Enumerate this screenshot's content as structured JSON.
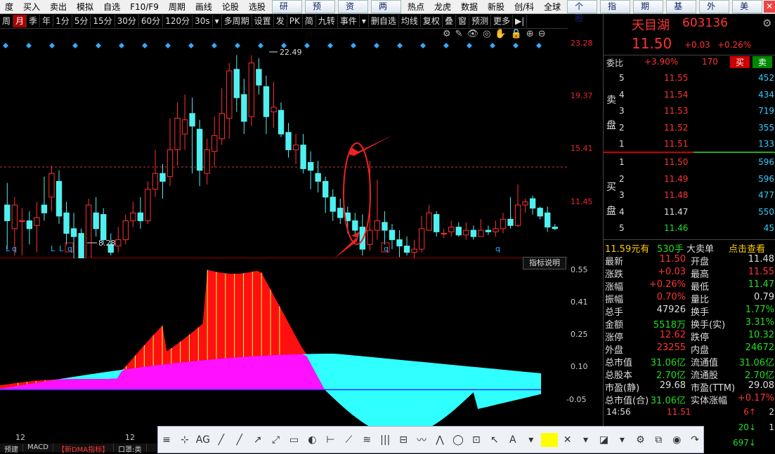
{
  "menu": {
    "items": [
      "买入",
      "卖出",
      "模拟",
      "自选",
      "F10/F9",
      "周期",
      "画线",
      "论股",
      "选股"
    ],
    "lead": "度",
    "tabs": [
      "研报",
      "预测",
      "资金",
      "两融"
    ],
    "items2": [
      "热点",
      "龙虎",
      "数据",
      "新股",
      "创/科",
      "全球"
    ],
    "tabs2": [
      "个股",
      "指数",
      "期货",
      "基金",
      "外汇",
      "美股"
    ],
    "close": "✕"
  },
  "periods": [
    "周",
    "月",
    "季",
    "年",
    "1分",
    "5分",
    "15分",
    "30分",
    "60分",
    "120分",
    "30s",
    "▾",
    "多周期",
    "设置",
    "发",
    "PK",
    "简",
    "九转",
    "事件",
    "▾",
    "删自选",
    "均线",
    "复权",
    "叠",
    "窗",
    "预测",
    "更多",
    "▶|"
  ],
  "period_selected": 1,
  "y_labels": [
    "23.28",
    "19.37",
    "15.41",
    "11.45"
  ],
  "price_annotations": {
    "high": "22.49",
    "low": "8.28"
  },
  "markers": [
    "L",
    "q",
    "L",
    "L",
    "q",
    "q",
    "q"
  ],
  "indicator": {
    "button": "指标说明",
    "y_labels": [
      "0.55",
      "0.41",
      "0.25",
      "0.10",
      "-0.05"
    ]
  },
  "x_labels": [
    "12",
    "12"
  ],
  "stock": {
    "name": "天目湖",
    "code": "603136",
    "price": "11.50",
    "change": "+0.03",
    "pct": "+0.26%"
  },
  "weibi": {
    "label": "委比",
    "value": "+3.90%",
    "diff": "170",
    "buy_btn": "买",
    "sell_btn": "卖"
  },
  "sell_label": [
    "卖",
    "盘"
  ],
  "buy_label": [
    "买",
    "盘"
  ],
  "asks": [
    {
      "lvl": "5",
      "price": "11.55",
      "vol": "452"
    },
    {
      "lvl": "4",
      "price": "11.54",
      "vol": "434"
    },
    {
      "lvl": "3",
      "price": "11.53",
      "vol": "719"
    },
    {
      "lvl": "2",
      "price": "11.52",
      "vol": "355"
    },
    {
      "lvl": "1",
      "price": "11.51",
      "vol": "133"
    }
  ],
  "bids": [
    {
      "lvl": "1",
      "price": "11.50",
      "vol": "596"
    },
    {
      "lvl": "2",
      "price": "11.49",
      "vol": "596"
    },
    {
      "lvl": "3",
      "price": "11.48",
      "vol": "477"
    },
    {
      "lvl": "4",
      "price": "11.47",
      "vol": "550"
    },
    {
      "lvl": "5",
      "price": "11.46",
      "vol": "45"
    }
  ],
  "bigorder": {
    "p": "11.59元有",
    "v": "530手",
    "t": "大卖单",
    "link": "点击查看"
  },
  "stats": [
    [
      "最新",
      "11.50",
      "开盘",
      "11.48"
    ],
    [
      "涨跌",
      "+0.03",
      "最高",
      "11.55"
    ],
    [
      "涨幅",
      "+0.26%",
      "最低",
      "11.47"
    ],
    [
      "振幅",
      "0.70%",
      "量比",
      "0.79"
    ],
    [
      "总手",
      "47926",
      "换手",
      "1.77%"
    ],
    [
      "金额",
      "5518万",
      "换手(实)",
      "3.31%"
    ],
    [
      "涨停",
      "12.62",
      "跌停",
      "10.32"
    ],
    [
      "外盘",
      "23255",
      "内盘",
      "24672"
    ],
    [
      "总市值",
      "31.06亿",
      "流通值",
      "31.06亿"
    ],
    [
      "总股本",
      "2.70亿",
      "流通股",
      "2.70亿"
    ],
    [
      "市盈(静)",
      "29.68",
      "市盈(TTM)",
      "29.08"
    ],
    [
      "总市值(合)",
      "31.06亿",
      "实体涨幅",
      "+0.17%"
    ]
  ],
  "ticks": [
    {
      "time": "14:56",
      "price": "11.51",
      "vol": "6↑",
      "n": "2"
    },
    {
      "time": "",
      "price": "",
      "vol": "20↓",
      "n": "1"
    },
    {
      "time": "",
      "price": "",
      "vol": "697↓",
      "n": ""
    }
  ],
  "bottom_tabs": [
    "预建",
    "MACD",
    "【新DMA指标】",
    "口罩:类"
  ],
  "drawtools": [
    "≡",
    "⊹",
    "AG",
    "╱",
    "╱",
    "↗",
    "⤢",
    "▭",
    "◐",
    "⊢",
    "⟋",
    "≋",
    "|||",
    "⊟",
    "〰",
    "⋀",
    "◯",
    "⊡",
    "↖",
    "A",
    "▾",
    "■",
    "✕",
    "▾",
    "◪",
    "▾",
    "⚙",
    "⧉",
    "◉",
    "↷"
  ],
  "gear": "⚙"
}
